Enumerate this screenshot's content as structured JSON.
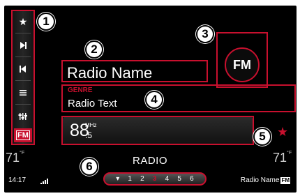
{
  "sidebar": {
    "items": [
      {
        "icon": "star-icon",
        "glyph": "★"
      },
      {
        "icon": "seek-forward-icon",
        "glyph": "⏭"
      },
      {
        "icon": "seek-back-icon",
        "glyph": "⏮"
      },
      {
        "icon": "browse-list-icon",
        "glyph": "≡"
      },
      {
        "icon": "audio-settings-icon",
        "glyph": "♫"
      }
    ],
    "fm_label": "FM"
  },
  "callouts": [
    "1",
    "2",
    "3",
    "4",
    "5",
    "6"
  ],
  "station": {
    "name": "Radio Name",
    "genre": "GENRE",
    "text": "Radio Text",
    "band": "FM",
    "frequency_main": "88",
    "frequency_decimal": ".5",
    "frequency_unit": "MHz"
  },
  "climate": {
    "left_temp": "71",
    "right_temp": "71",
    "unit": "°F"
  },
  "status": {
    "source_title": "RADIO",
    "clock": "14:17",
    "now_playing": "Radio Name",
    "now_playing_badge": "FM"
  },
  "presets": {
    "items": [
      "1",
      "2",
      "3",
      "4",
      "5",
      "6"
    ],
    "active": "3"
  },
  "colors": {
    "accent": "#c8102e",
    "background": "#000000",
    "text": "#ffffff"
  }
}
